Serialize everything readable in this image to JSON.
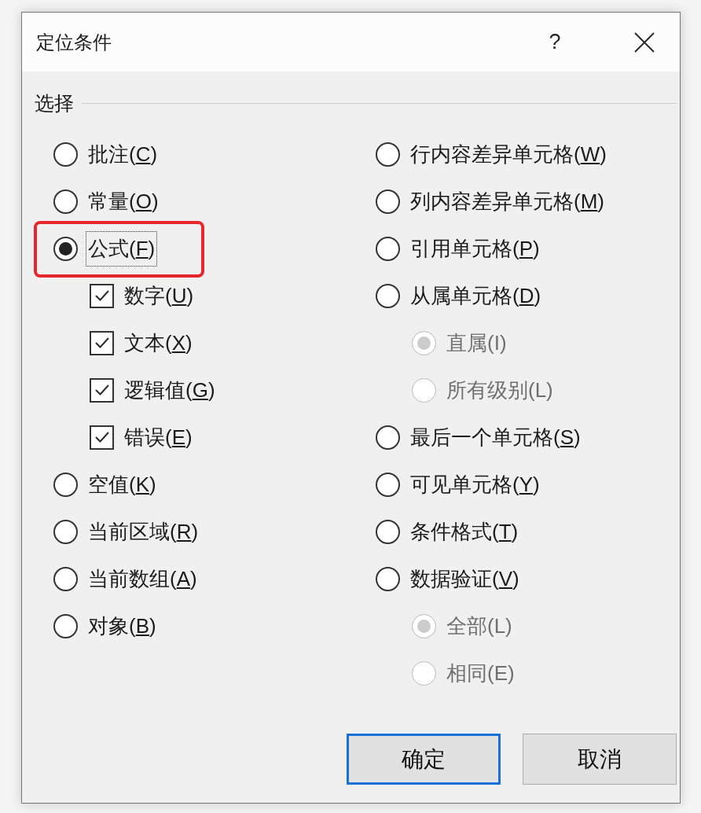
{
  "window": {
    "title": "定位条件",
    "help_button": "?"
  },
  "group": {
    "label": "选择"
  },
  "left_column": [
    {
      "kind": "radio",
      "label": "批注(",
      "access_key": "C",
      "suffix": ")",
      "selected": false,
      "focused": false,
      "highlighted": false
    },
    {
      "kind": "radio",
      "label": "常量(",
      "access_key": "O",
      "suffix": ")",
      "selected": false,
      "focused": false,
      "highlighted": false
    },
    {
      "kind": "radio",
      "label": "公式(",
      "access_key": "F",
      "suffix": ")",
      "selected": true,
      "focused": true,
      "highlighted": true,
      "children": [
        {
          "kind": "checkbox",
          "label": "数字(",
          "access_key": "U",
          "suffix": ")",
          "checked": true
        },
        {
          "kind": "checkbox",
          "label": "文本(",
          "access_key": "X",
          "suffix": ")",
          "checked": true
        },
        {
          "kind": "checkbox",
          "label": "逻辑值(",
          "access_key": "G",
          "suffix": ")",
          "checked": true
        },
        {
          "kind": "checkbox",
          "label": "错误(",
          "access_key": "E",
          "suffix": ")",
          "checked": true
        }
      ]
    },
    {
      "kind": "radio",
      "label": "空值(",
      "access_key": "K",
      "suffix": ")",
      "selected": false,
      "focused": false,
      "highlighted": false
    },
    {
      "kind": "radio",
      "label": "当前区域(",
      "access_key": "R",
      "suffix": ")",
      "selected": false,
      "focused": false,
      "highlighted": false
    },
    {
      "kind": "radio",
      "label": "当前数组(",
      "access_key": "A",
      "suffix": ")",
      "selected": false,
      "focused": false,
      "highlighted": false
    },
    {
      "kind": "radio",
      "label": "对象(",
      "access_key": "B",
      "suffix": ")",
      "selected": false,
      "focused": false,
      "highlighted": false
    }
  ],
  "right_column": [
    {
      "kind": "radio",
      "label": "行内容差异单元格(",
      "access_key": "W",
      "suffix": ")",
      "selected": false,
      "focused": false,
      "highlighted": false
    },
    {
      "kind": "radio",
      "label": "列内容差异单元格(",
      "access_key": "M",
      "suffix": ")",
      "selected": false,
      "focused": false,
      "highlighted": false
    },
    {
      "kind": "radio",
      "label": "引用单元格(",
      "access_key": "P",
      "suffix": ")",
      "selected": false,
      "focused": false,
      "highlighted": false
    },
    {
      "kind": "radio",
      "label": "从属单元格(",
      "access_key": "D",
      "suffix": ")",
      "selected": false,
      "focused": false,
      "highlighted": false,
      "children": [
        {
          "kind": "radio",
          "label": "直属(I)",
          "selected": true,
          "disabled": true
        },
        {
          "kind": "radio",
          "label": "所有级别(L)",
          "selected": false,
          "disabled": true
        }
      ]
    },
    {
      "kind": "radio",
      "label": "最后一个单元格(",
      "access_key": "S",
      "suffix": ")",
      "selected": false,
      "focused": false,
      "highlighted": false
    },
    {
      "kind": "radio",
      "label": "可见单元格(",
      "access_key": "Y",
      "suffix": ")",
      "selected": false,
      "focused": false,
      "highlighted": false
    },
    {
      "kind": "radio",
      "label": "条件格式(",
      "access_key": "T",
      "suffix": ")",
      "selected": false,
      "focused": false,
      "highlighted": false
    },
    {
      "kind": "radio",
      "label": "数据验证(",
      "access_key": "V",
      "suffix": ")",
      "selected": false,
      "focused": false,
      "highlighted": false,
      "children": [
        {
          "kind": "radio",
          "label": "全部(L)",
          "selected": true,
          "disabled": true
        },
        {
          "kind": "radio",
          "label": "相同(E)",
          "selected": false,
          "disabled": true
        }
      ]
    }
  ],
  "buttons": [
    {
      "label": "确定",
      "default": true
    },
    {
      "label": "取消",
      "default": false
    }
  ]
}
